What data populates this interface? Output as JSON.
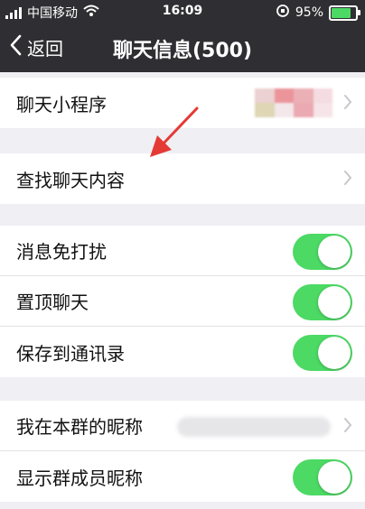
{
  "status_bar": {
    "carrier": "中国移动",
    "time": "16:09",
    "battery_percent": "95%",
    "battery_level": 0.95
  },
  "nav": {
    "back_label": "返回",
    "title": "聊天信息(500)"
  },
  "settings": {
    "mini_programs": "聊天小程序",
    "search_chat": "查找聊天内容",
    "mute": "消息免打扰",
    "pin": "置顶聊天",
    "save_contacts": "保存到通讯录",
    "my_group_nickname": "我在本群的昵称",
    "show_member_nicknames": "显示群成员昵称"
  },
  "toggles": {
    "mute_on": true,
    "pin_on": true,
    "save_contacts_on": true,
    "show_member_nicknames_on": true
  },
  "colors": {
    "nav_bg": "#2f2f33",
    "toggle_on": "#4cd964",
    "annotation_arrow": "#e53935"
  }
}
